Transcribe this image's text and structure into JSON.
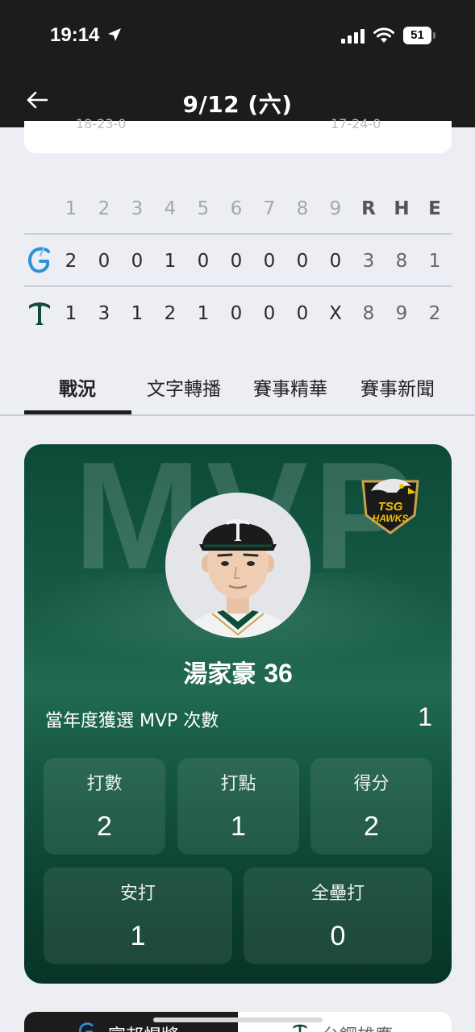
{
  "status": {
    "time": "19:14",
    "battery": "51"
  },
  "nav": {
    "title": "9/12 (六)"
  },
  "prev_card": {
    "left_record": "18-23-0",
    "right_record": "17-24-0"
  },
  "linescore": {
    "headers": [
      "1",
      "2",
      "3",
      "4",
      "5",
      "6",
      "7",
      "8",
      "9",
      "R",
      "H",
      "E"
    ],
    "away": {
      "logo": "giants-logo-icon",
      "scores": [
        "2",
        "0",
        "0",
        "1",
        "0",
        "0",
        "0",
        "0",
        "0",
        "3",
        "8",
        "1"
      ]
    },
    "home": {
      "logo": "hawks-t-logo-icon",
      "scores": [
        "1",
        "3",
        "1",
        "2",
        "1",
        "0",
        "0",
        "0",
        "X",
        "8",
        "9",
        "2"
      ]
    }
  },
  "tabs": [
    "戰況",
    "文字轉播",
    "賽事精華",
    "賽事新聞"
  ],
  "mvp": {
    "watermark": "MVP",
    "badge": "TSG HAWKS",
    "player_name": "湯家豪",
    "player_number": "36",
    "count_label": "當年度獲選 MVP 次數",
    "count_value": "1",
    "stats": [
      {
        "label": "打數",
        "value": "2"
      },
      {
        "label": "打點",
        "value": "1"
      },
      {
        "label": "得分",
        "value": "2"
      },
      {
        "label": "安打",
        "value": "1"
      },
      {
        "label": "全壘打",
        "value": "0"
      }
    ]
  },
  "bottom": {
    "left_label": "富邦悍將",
    "right_label": "台鋼雄鷹"
  },
  "colors": {
    "accent_green": "#0e4d39",
    "dark": "#1c1c1c",
    "giants_blue": "#2f8fd8"
  }
}
